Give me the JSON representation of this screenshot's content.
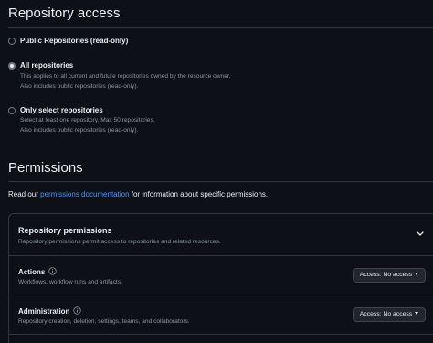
{
  "repository_access": {
    "title": "Repository access",
    "options": [
      {
        "label": "Public Repositories (read-only)",
        "selected": false,
        "description": []
      },
      {
        "label": "All repositories",
        "selected": true,
        "description": [
          "This applies to all current and future repositories owned by the resource owner.",
          "Also includes public repositories (read-only)."
        ]
      },
      {
        "label": "Only select repositories",
        "selected": false,
        "description": [
          "Select at least one repository. Max 50 repositories.",
          "Also includes public repositories (read-only)."
        ]
      }
    ]
  },
  "permissions": {
    "title": "Permissions",
    "intro_prefix": "Read our ",
    "intro_link": "permissions documentation",
    "intro_suffix": " for information about specific permissions.",
    "repository_permissions": {
      "title": "Repository permissions",
      "description": "Repository permissions permit access to repositories and related resources.",
      "rows": [
        {
          "name": "Actions",
          "description": "Workflows, workflow runs and artifacts.",
          "access": "Access: No access"
        },
        {
          "name": "Administration",
          "description": "Repository creation, deletion, settings, teams, and collaborators.",
          "access": "Access: No access"
        }
      ]
    }
  },
  "colors": {
    "background": "#0d1117",
    "text": "#e6edf3",
    "muted": "#8b949e",
    "link": "#4493f8",
    "border": "#30363d",
    "button": "#21262d"
  },
  "icons": {
    "info": "info-circle-icon",
    "chevron": "chevron-down-icon",
    "caret": "triangle-down-icon"
  }
}
